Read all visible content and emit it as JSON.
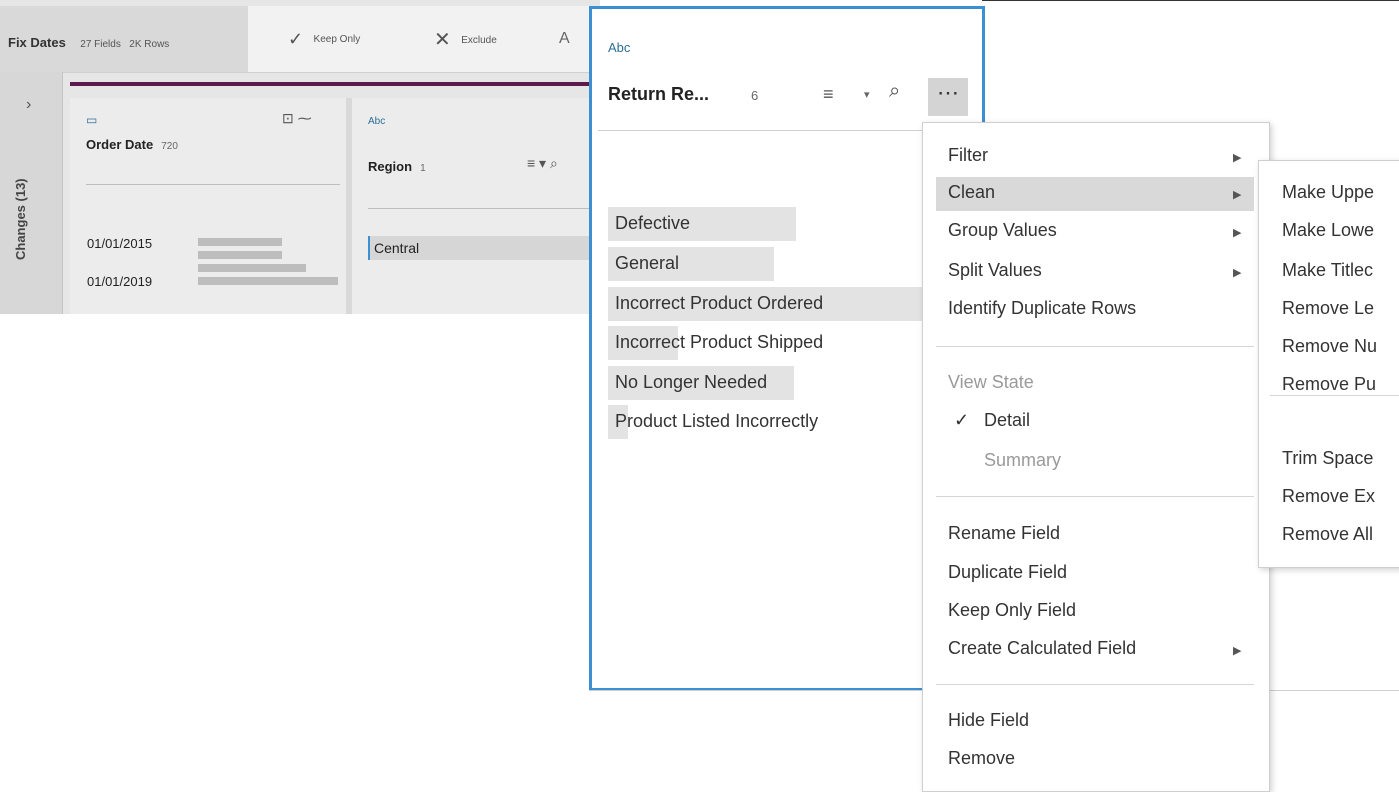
{
  "toolbar": {
    "step_name": "Fix Dates",
    "step_fields": "27 Fields",
    "step_rows": "2K Rows",
    "keep_only_label": "Keep Only",
    "exclude_label": "Exclude",
    "cut_label": "A"
  },
  "changes_rail": {
    "label": "Changes (13)",
    "expand_icon": "chevron-right-icon"
  },
  "order_date_card": {
    "type_icon": "calendar-icon",
    "name": "Order Date",
    "count": "720",
    "dates": [
      "01/01/2015",
      "01/01/2019"
    ]
  },
  "region_card": {
    "type": "Abc",
    "name": "Region",
    "count": "1",
    "values": [
      "Central"
    ]
  },
  "field_card": {
    "type": "Abc",
    "name": "Return Re...",
    "count": "6",
    "values": [
      {
        "label": "Defective",
        "fill": 0.58
      },
      {
        "label": "General",
        "fill": 0.51
      },
      {
        "label": "Incorrect Product Ordered",
        "fill": 1.0
      },
      {
        "label": "Incorrect Product Shipped",
        "fill": 0.22
      },
      {
        "label": "No Longer Needed",
        "fill": 0.58
      },
      {
        "label": "Product Listed Incorrectly",
        "fill": 0.06
      }
    ]
  },
  "context_menu": {
    "filter": "Filter",
    "clean": "Clean",
    "group_values": "Group Values",
    "split_values": "Split Values",
    "identify_duplicates": "Identify Duplicate Rows",
    "view_state": "View State",
    "detail": "Detail",
    "summary": "Summary",
    "rename_field": "Rename Field",
    "duplicate_field": "Duplicate Field",
    "keep_only_field": "Keep Only Field",
    "create_calculated_field": "Create Calculated Field",
    "hide_field": "Hide Field",
    "remove": "Remove"
  },
  "clean_submenu": {
    "items_group1": [
      "Make Uppe",
      "Make Lowe",
      "Make Titlec",
      "Remove Le",
      "Remove Nu",
      "Remove Pu"
    ],
    "items_group2": [
      "Trim Space",
      "Remove Ex",
      "Remove All"
    ]
  }
}
